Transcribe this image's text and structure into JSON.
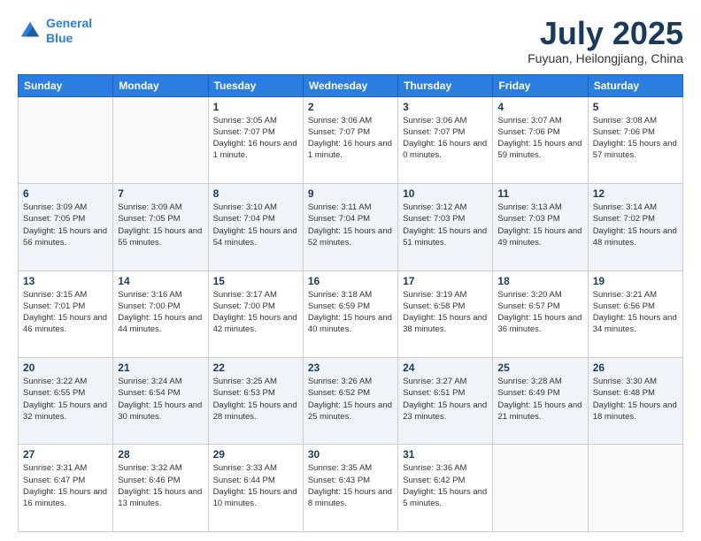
{
  "header": {
    "logo_line1": "General",
    "logo_line2": "Blue",
    "month_title": "July 2025",
    "location": "Fuyuan, Heilongjiang, China"
  },
  "weekdays": [
    "Sunday",
    "Monday",
    "Tuesday",
    "Wednesday",
    "Thursday",
    "Friday",
    "Saturday"
  ],
  "rows": [
    [
      {
        "day": "",
        "info": ""
      },
      {
        "day": "",
        "info": ""
      },
      {
        "day": "1",
        "info": "Sunrise: 3:05 AM\nSunset: 7:07 PM\nDaylight: 16 hours\nand 1 minute."
      },
      {
        "day": "2",
        "info": "Sunrise: 3:06 AM\nSunset: 7:07 PM\nDaylight: 16 hours\nand 1 minute."
      },
      {
        "day": "3",
        "info": "Sunrise: 3:06 AM\nSunset: 7:07 PM\nDaylight: 16 hours\nand 0 minutes."
      },
      {
        "day": "4",
        "info": "Sunrise: 3:07 AM\nSunset: 7:06 PM\nDaylight: 15 hours\nand 59 minutes."
      },
      {
        "day": "5",
        "info": "Sunrise: 3:08 AM\nSunset: 7:06 PM\nDaylight: 15 hours\nand 57 minutes."
      }
    ],
    [
      {
        "day": "6",
        "info": "Sunrise: 3:09 AM\nSunset: 7:05 PM\nDaylight: 15 hours\nand 56 minutes."
      },
      {
        "day": "7",
        "info": "Sunrise: 3:09 AM\nSunset: 7:05 PM\nDaylight: 15 hours\nand 55 minutes."
      },
      {
        "day": "8",
        "info": "Sunrise: 3:10 AM\nSunset: 7:04 PM\nDaylight: 15 hours\nand 54 minutes."
      },
      {
        "day": "9",
        "info": "Sunrise: 3:11 AM\nSunset: 7:04 PM\nDaylight: 15 hours\nand 52 minutes."
      },
      {
        "day": "10",
        "info": "Sunrise: 3:12 AM\nSunset: 7:03 PM\nDaylight: 15 hours\nand 51 minutes."
      },
      {
        "day": "11",
        "info": "Sunrise: 3:13 AM\nSunset: 7:03 PM\nDaylight: 15 hours\nand 49 minutes."
      },
      {
        "day": "12",
        "info": "Sunrise: 3:14 AM\nSunset: 7:02 PM\nDaylight: 15 hours\nand 48 minutes."
      }
    ],
    [
      {
        "day": "13",
        "info": "Sunrise: 3:15 AM\nSunset: 7:01 PM\nDaylight: 15 hours\nand 46 minutes."
      },
      {
        "day": "14",
        "info": "Sunrise: 3:16 AM\nSunset: 7:00 PM\nDaylight: 15 hours\nand 44 minutes."
      },
      {
        "day": "15",
        "info": "Sunrise: 3:17 AM\nSunset: 7:00 PM\nDaylight: 15 hours\nand 42 minutes."
      },
      {
        "day": "16",
        "info": "Sunrise: 3:18 AM\nSunset: 6:59 PM\nDaylight: 15 hours\nand 40 minutes."
      },
      {
        "day": "17",
        "info": "Sunrise: 3:19 AM\nSunset: 6:58 PM\nDaylight: 15 hours\nand 38 minutes."
      },
      {
        "day": "18",
        "info": "Sunrise: 3:20 AM\nSunset: 6:57 PM\nDaylight: 15 hours\nand 36 minutes."
      },
      {
        "day": "19",
        "info": "Sunrise: 3:21 AM\nSunset: 6:56 PM\nDaylight: 15 hours\nand 34 minutes."
      }
    ],
    [
      {
        "day": "20",
        "info": "Sunrise: 3:22 AM\nSunset: 6:55 PM\nDaylight: 15 hours\nand 32 minutes."
      },
      {
        "day": "21",
        "info": "Sunrise: 3:24 AM\nSunset: 6:54 PM\nDaylight: 15 hours\nand 30 minutes."
      },
      {
        "day": "22",
        "info": "Sunrise: 3:25 AM\nSunset: 6:53 PM\nDaylight: 15 hours\nand 28 minutes."
      },
      {
        "day": "23",
        "info": "Sunrise: 3:26 AM\nSunset: 6:52 PM\nDaylight: 15 hours\nand 25 minutes."
      },
      {
        "day": "24",
        "info": "Sunrise: 3:27 AM\nSunset: 6:51 PM\nDaylight: 15 hours\nand 23 minutes."
      },
      {
        "day": "25",
        "info": "Sunrise: 3:28 AM\nSunset: 6:49 PM\nDaylight: 15 hours\nand 21 minutes."
      },
      {
        "day": "26",
        "info": "Sunrise: 3:30 AM\nSunset: 6:48 PM\nDaylight: 15 hours\nand 18 minutes."
      }
    ],
    [
      {
        "day": "27",
        "info": "Sunrise: 3:31 AM\nSunset: 6:47 PM\nDaylight: 15 hours\nand 16 minutes."
      },
      {
        "day": "28",
        "info": "Sunrise: 3:32 AM\nSunset: 6:46 PM\nDaylight: 15 hours\nand 13 minutes."
      },
      {
        "day": "29",
        "info": "Sunrise: 3:33 AM\nSunset: 6:44 PM\nDaylight: 15 hours\nand 10 minutes."
      },
      {
        "day": "30",
        "info": "Sunrise: 3:35 AM\nSunset: 6:43 PM\nDaylight: 15 hours\nand 8 minutes."
      },
      {
        "day": "31",
        "info": "Sunrise: 3:36 AM\nSunset: 6:42 PM\nDaylight: 15 hours\nand 5 minutes."
      },
      {
        "day": "",
        "info": ""
      },
      {
        "day": "",
        "info": ""
      }
    ]
  ]
}
